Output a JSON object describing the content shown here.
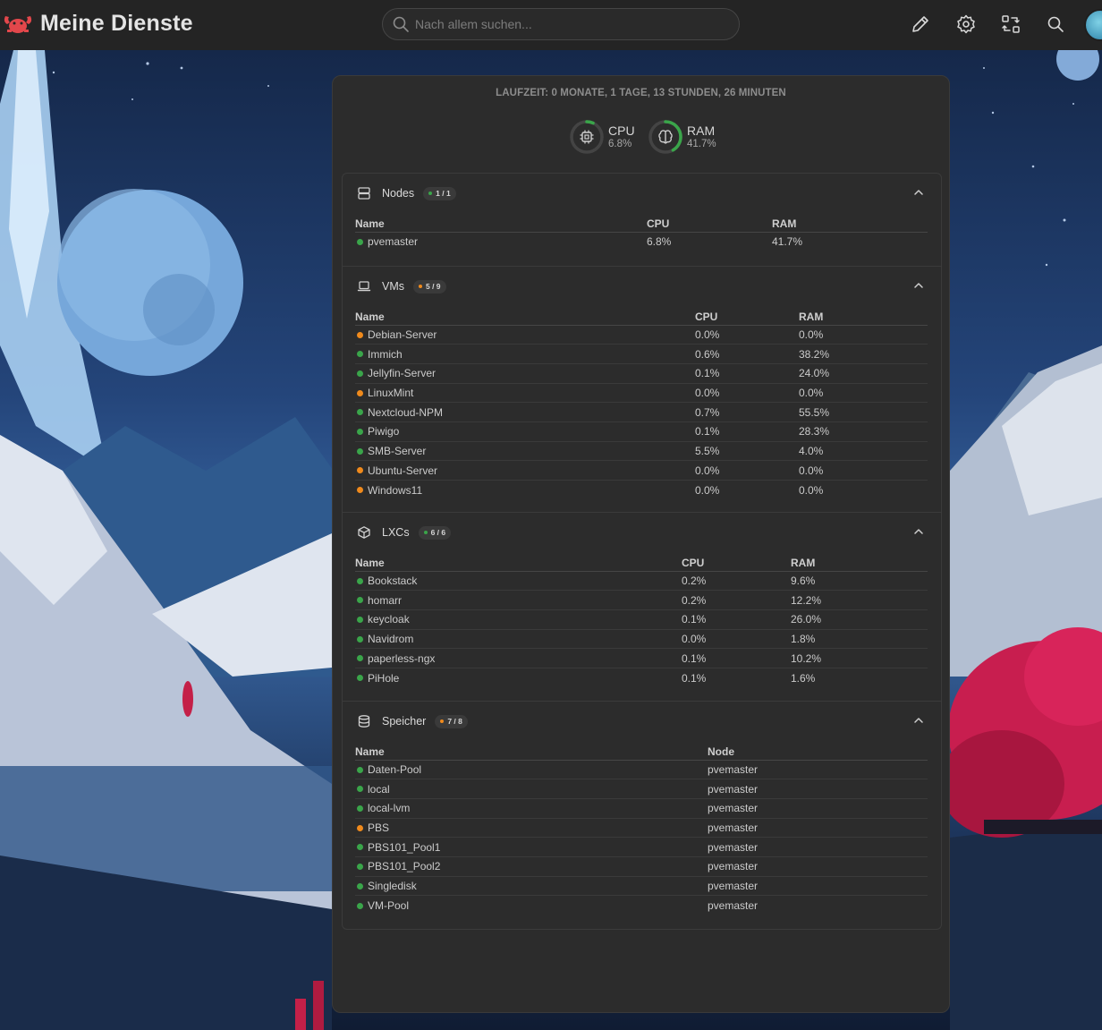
{
  "header": {
    "app_title": "Meine Dienste",
    "search_placeholder": "Nach allem suchen..."
  },
  "colors": {
    "topbar": "#242424",
    "panel": "#2c2c2c",
    "status_ok": "#3aa54a",
    "status_stopped": "#f08a1c"
  },
  "summary": {
    "uptime": "LAUFZEIT: 0 MONATE, 1 TAGE, 13 STUNDEN, 26 MINUTEN",
    "cpu_label": "CPU",
    "cpu_value": "6.8%",
    "cpu_fraction": 0.068,
    "ram_label": "RAM",
    "ram_value": "41.7%",
    "ram_fraction": 0.417
  },
  "nodes": {
    "title": "Nodes",
    "badge": "1 / 1",
    "columns": [
      "Name",
      "CPU",
      "RAM"
    ],
    "rows": [
      {
        "name": "pvemaster",
        "cpu": "6.8%",
        "ram": "41.7%",
        "status": "ok"
      }
    ]
  },
  "vms": {
    "title": "VMs",
    "badge": "5 / 9",
    "columns": [
      "Name",
      "CPU",
      "RAM"
    ],
    "rows": [
      {
        "name": "Debian-Server",
        "cpu": "0.0%",
        "ram": "0.0%",
        "status": "off"
      },
      {
        "name": "Immich",
        "cpu": "0.6%",
        "ram": "38.2%",
        "status": "ok"
      },
      {
        "name": "Jellyfin-Server",
        "cpu": "0.1%",
        "ram": "24.0%",
        "status": "ok"
      },
      {
        "name": "LinuxMint",
        "cpu": "0.0%",
        "ram": "0.0%",
        "status": "off"
      },
      {
        "name": "Nextcloud-NPM",
        "cpu": "0.7%",
        "ram": "55.5%",
        "status": "ok"
      },
      {
        "name": "Piwigo",
        "cpu": "0.1%",
        "ram": "28.3%",
        "status": "ok"
      },
      {
        "name": "SMB-Server",
        "cpu": "5.5%",
        "ram": "4.0%",
        "status": "ok"
      },
      {
        "name": "Ubuntu-Server",
        "cpu": "0.0%",
        "ram": "0.0%",
        "status": "off"
      },
      {
        "name": "Windows11",
        "cpu": "0.0%",
        "ram": "0.0%",
        "status": "off"
      }
    ]
  },
  "lxcs": {
    "title": "LXCs",
    "badge": "6 / 6",
    "columns": [
      "Name",
      "CPU",
      "RAM"
    ],
    "rows": [
      {
        "name": "Bookstack",
        "cpu": "0.2%",
        "ram": "9.6%",
        "status": "ok"
      },
      {
        "name": "homarr",
        "cpu": "0.2%",
        "ram": "12.2%",
        "status": "ok"
      },
      {
        "name": "keycloak",
        "cpu": "0.1%",
        "ram": "26.0%",
        "status": "ok"
      },
      {
        "name": "Navidrom",
        "cpu": "0.0%",
        "ram": "1.8%",
        "status": "ok"
      },
      {
        "name": "paperless-ngx",
        "cpu": "0.1%",
        "ram": "10.2%",
        "status": "ok"
      },
      {
        "name": "PiHole",
        "cpu": "0.1%",
        "ram": "1.6%",
        "status": "ok"
      }
    ]
  },
  "storage": {
    "title": "Speicher",
    "badge": "7 / 8",
    "columns": [
      "Name",
      "Node"
    ],
    "rows": [
      {
        "name": "Daten-Pool",
        "node": "pvemaster",
        "status": "ok"
      },
      {
        "name": "local",
        "node": "pvemaster",
        "status": "ok"
      },
      {
        "name": "local-lvm",
        "node": "pvemaster",
        "status": "ok"
      },
      {
        "name": "PBS",
        "node": "pvemaster",
        "status": "off"
      },
      {
        "name": "PBS101_Pool1",
        "node": "pvemaster",
        "status": "ok"
      },
      {
        "name": "PBS101_Pool2",
        "node": "pvemaster",
        "status": "ok"
      },
      {
        "name": "Singledisk",
        "node": "pvemaster",
        "status": "ok"
      },
      {
        "name": "VM-Pool",
        "node": "pvemaster",
        "status": "ok"
      }
    ]
  }
}
